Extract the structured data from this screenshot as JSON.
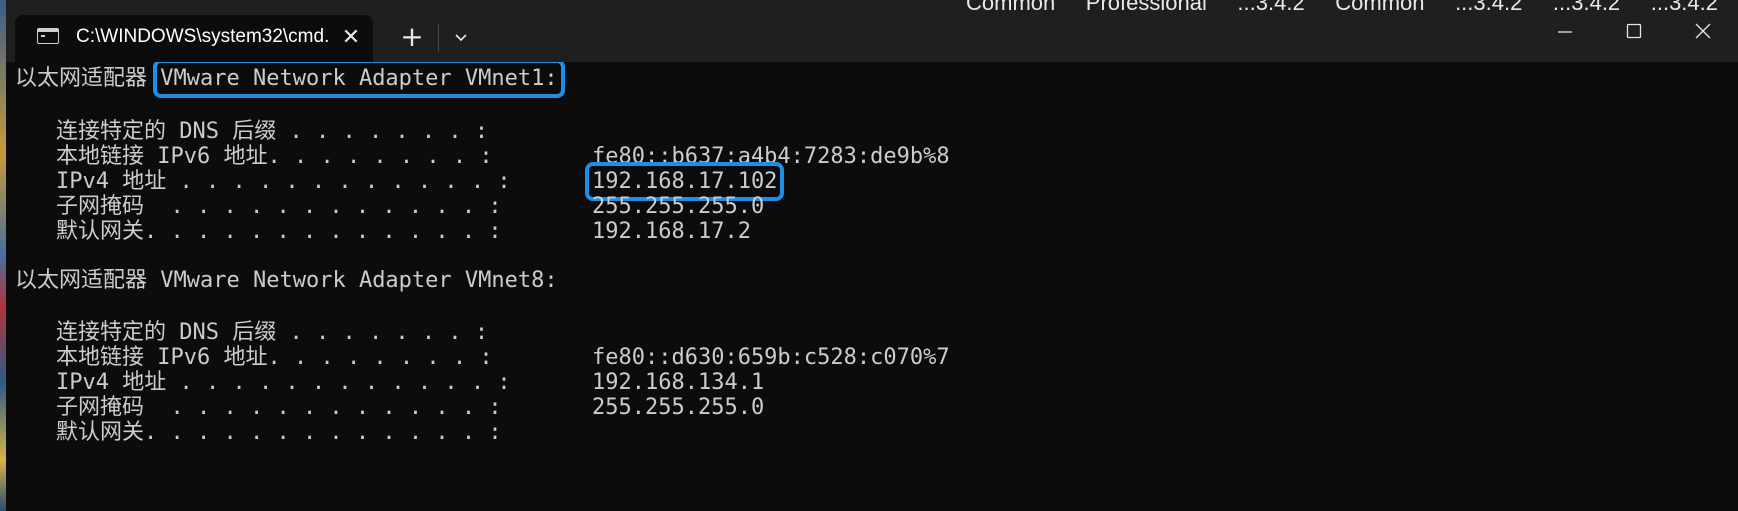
{
  "window": {
    "tab_title": "C:\\WINDOWS\\system32\\cmd.",
    "tab_close_glyph": "✕",
    "new_tab_glyph": "+",
    "background_text": "Common     Professional     ...3.4.2     Common     ...3.4.2     ...3.4.2     ...3.4.2",
    "icons": {
      "terminal": "cmd-terminal-icon",
      "close_tab": "close-icon",
      "new_tab": "plus-icon",
      "dropdown": "chevron-down-icon",
      "minimize": "minimize-icon",
      "maximize": "maximize-icon",
      "close": "close-icon"
    },
    "colors": {
      "titlebar": "#1f1f1f",
      "console_bg": "#0c0c0c",
      "console_text": "#cccccc",
      "highlight": "#1e8fe6"
    }
  },
  "adapters": [
    {
      "header_prefix": "以太网适配器",
      "name": "VMware Network Adapter VMnet1:",
      "rows": [
        {
          "label": "连接特定的 DNS 后缀 . . . . . . . :",
          "value": ""
        },
        {
          "label": "本地链接 IPv6 地址. . . . . . . . :",
          "value": "fe80::b637:a4b4:7283:de9b%8"
        },
        {
          "label": "IPv4 地址 . . . . . . . . . . . . :",
          "value": "192.168.17.102"
        },
        {
          "label": "子网掩码  . . . . . . . . . . . . :",
          "value": "255.255.255.0"
        },
        {
          "label": "默认网关. . . . . . . . . . . . . :",
          "value": "192.168.17.2"
        }
      ]
    },
    {
      "header_prefix": "以太网适配器",
      "name": "VMware Network Adapter VMnet8:",
      "rows": [
        {
          "label": "连接特定的 DNS 后缀 . . . . . . . :",
          "value": ""
        },
        {
          "label": "本地链接 IPv6 地址. . . . . . . . :",
          "value": "fe80::d630:659b:c528:c070%7"
        },
        {
          "label": "IPv4 地址 . . . . . . . . . . . . :",
          "value": "192.168.134.1"
        },
        {
          "label": "子网掩码  . . . . . . . . . . . . :",
          "value": "255.255.255.0"
        },
        {
          "label": "默认网关. . . . . . . . . . . . . :",
          "value": ""
        }
      ]
    }
  ]
}
